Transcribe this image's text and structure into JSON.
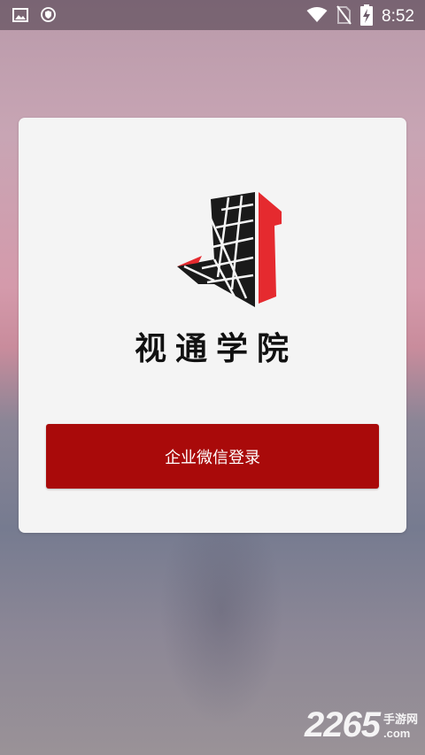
{
  "status_bar": {
    "time": "8:52",
    "icons": [
      "gallery-icon",
      "shield-icon",
      "wifi-icon",
      "no-sim-icon",
      "battery-charging-icon"
    ]
  },
  "app": {
    "title": "视通学院",
    "logo": "shitong-logo"
  },
  "login": {
    "button_label": "企业微信登录"
  },
  "watermark": {
    "number": "2265",
    "label": "手游网",
    "domain": ".com"
  },
  "colors": {
    "accent": "#a90a0a",
    "logo_red": "#e52a2f",
    "logo_dark": "#1a1a1a",
    "card": "#f4f4f4"
  }
}
